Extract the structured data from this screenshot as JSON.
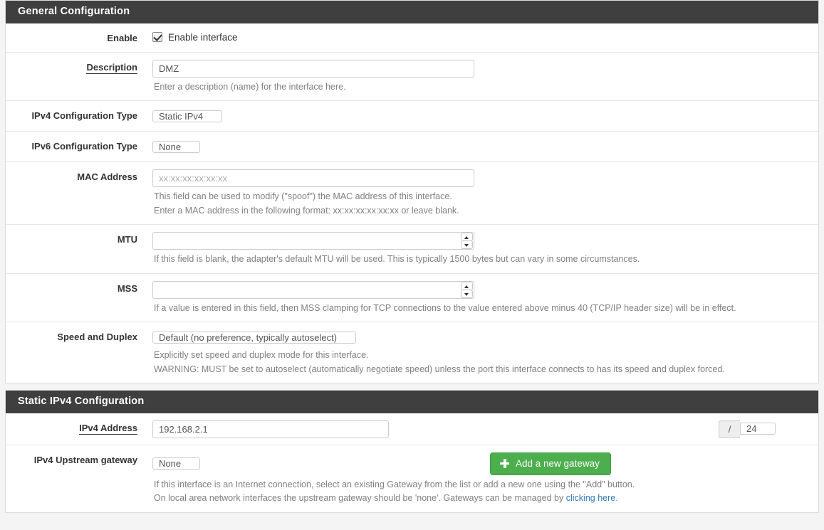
{
  "general": {
    "heading": "General Configuration",
    "enable": {
      "label": "Enable",
      "checkbox_label": "Enable interface",
      "checked": true
    },
    "description": {
      "label": "Description",
      "value": "DMZ",
      "help": "Enter a description (name) for the interface here."
    },
    "ipv4_config_type": {
      "label": "IPv4 Configuration Type",
      "value": "Static IPv4"
    },
    "ipv6_config_type": {
      "label": "IPv6 Configuration Type",
      "value": "None"
    },
    "mac_address": {
      "label": "MAC Address",
      "value": "",
      "placeholder": "xx:xx:xx:xx:xx:xx",
      "help_line1": "This field can be used to modify (\"spoof\") the MAC address of this interface.",
      "help_line2": "Enter a MAC address in the following format: xx:xx:xx:xx:xx:xx or leave blank."
    },
    "mtu": {
      "label": "MTU",
      "value": "",
      "help": "If this field is blank, the adapter's default MTU will be used. This is typically 1500 bytes but can vary in some circumstances."
    },
    "mss": {
      "label": "MSS",
      "value": "",
      "help": "If a value is entered in this field, then MSS clamping for TCP connections to the value entered above minus 40 (TCP/IP header size) will be in effect."
    },
    "speed_duplex": {
      "label": "Speed and Duplex",
      "value": "Default (no preference, typically autoselect)",
      "help_line1": "Explicitly set speed and duplex mode for this interface.",
      "help_line2": "WARNING: MUST be set to autoselect (automatically negotiate speed) unless the port this interface connects to has its speed and duplex forced."
    }
  },
  "static_ipv4": {
    "heading": "Static IPv4 Configuration",
    "ipv4_address": {
      "label": "IPv4 Address",
      "value": "192.168.2.1",
      "prefix_symbol": "/",
      "prefix_value": "24"
    },
    "upstream_gateway": {
      "label": "IPv4 Upstream gateway",
      "value": "None",
      "add_button_label": "Add a new gateway",
      "help_line1": "If this interface is an Internet connection, select an existing Gateway from the list or add a new one using the \"Add\" button.",
      "help_line2_before": "On local area network interfaces the upstream gateway should be 'none'. Gateways can be managed by ",
      "help_link": "clicking here",
      "help_line2_after": "."
    }
  }
}
